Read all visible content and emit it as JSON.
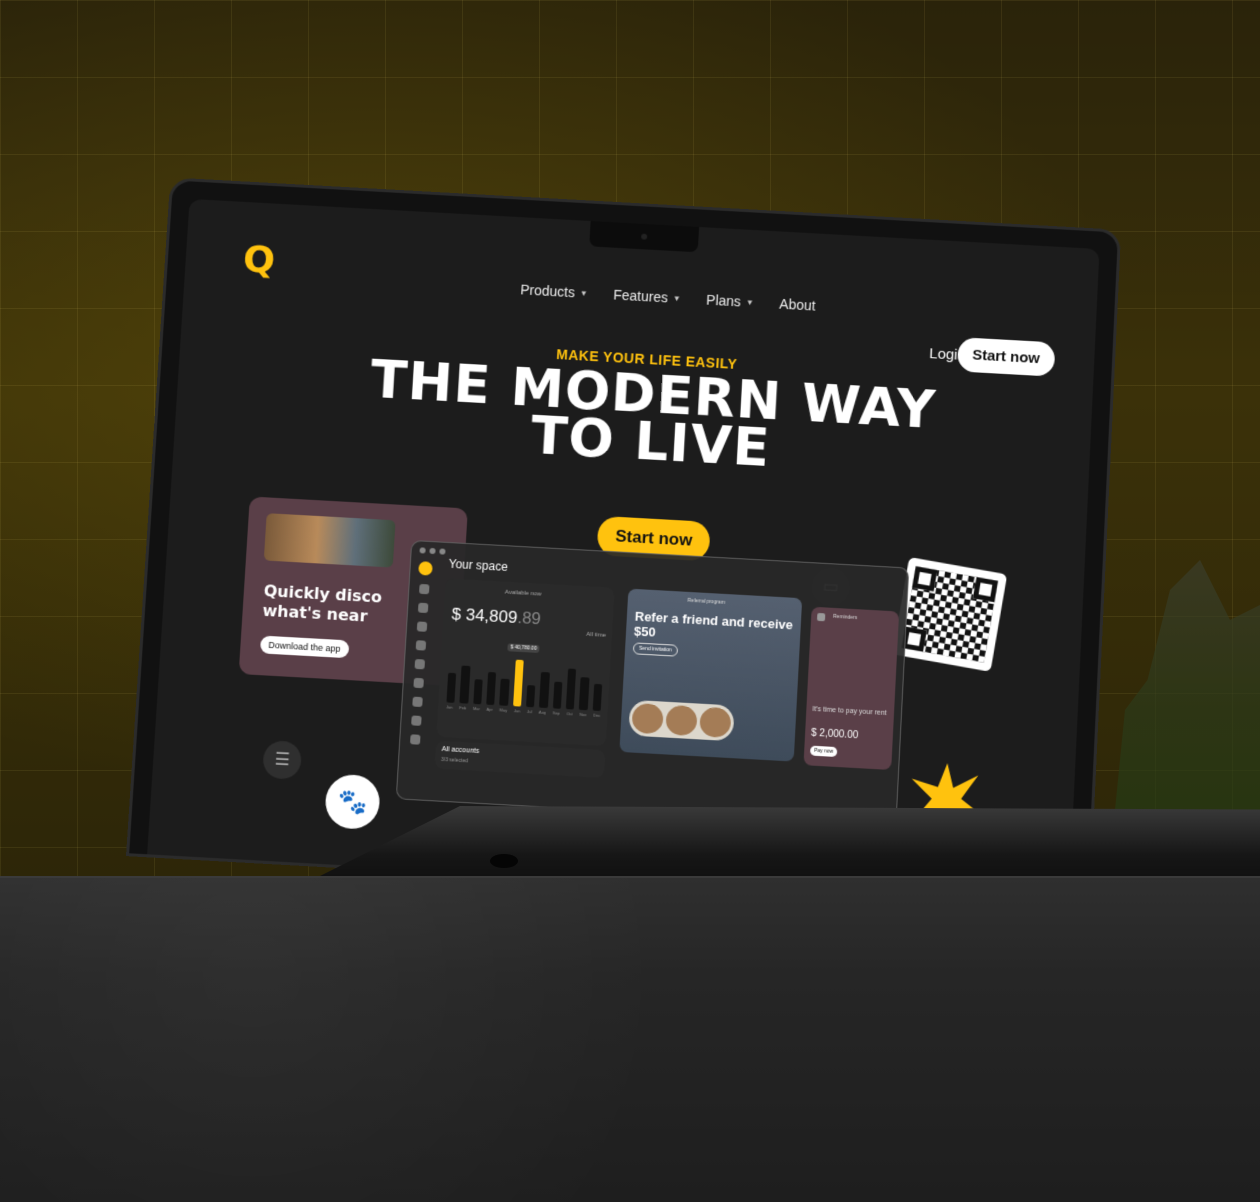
{
  "colors": {
    "accent": "#ffc20e",
    "screen_bg": "#1c1c1c",
    "card_mauve": "#5a3f48"
  },
  "logo": {
    "glyph": "Q"
  },
  "nav": {
    "items": [
      {
        "label": "Products",
        "has_dropdown": true
      },
      {
        "label": "Features",
        "has_dropdown": true
      },
      {
        "label": "Plans",
        "has_dropdown": true
      },
      {
        "label": "About",
        "has_dropdown": false
      }
    ],
    "login": "Login",
    "start_now": "Start now"
  },
  "hero": {
    "eyebrow": "MAKE YOUR LIFE EASILY",
    "headline": "THE MODERN WAY TO LIVE",
    "cta": "Start now"
  },
  "discover_card": {
    "line1": "Quickly disco",
    "line2": "what's near",
    "button": "Download the app"
  },
  "icons": {
    "card": "credit-card-icon",
    "food": "food-icon",
    "paw": "paw-icon",
    "qr": "qr-code"
  },
  "app": {
    "title": "Your space",
    "available_label": "Available now",
    "balance_main": "$ 34,809",
    "balance_cents": ".89",
    "time_filter": "All time",
    "tooltip": "$ 40,780.00",
    "bars": [
      0.55,
      0.7,
      0.45,
      0.6,
      0.5,
      0.85,
      0.4,
      0.65,
      0.5,
      0.75,
      0.6,
      0.5
    ],
    "highlight_bar_index": 5,
    "months": [
      "Jan",
      "Feb",
      "Mar",
      "Apr",
      "May",
      "Jun",
      "Jul",
      "Aug",
      "Sep",
      "Oct",
      "Nov",
      "Dec"
    ],
    "accounts_label": "All accounts",
    "accounts_selected": "3/3 selected",
    "referral_label": "Referral program",
    "referral_title": "Refer a friend and receive $50",
    "referral_button": "Send invitation",
    "reminder_label": "Reminders",
    "reminder_text": "It's time to pay your rent",
    "reminder_amount": "$ 2,000.00",
    "reminder_button": "Pay now"
  }
}
